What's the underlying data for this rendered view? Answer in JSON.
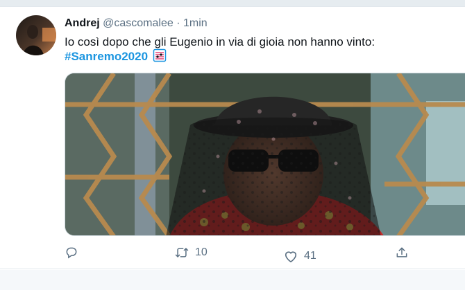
{
  "tweet": {
    "author_name": "Andrej",
    "author_handle": "@cascomalee",
    "separator": "·",
    "time": "1min",
    "text": "Io così dopo che gli Eugenio in via di gioia non hanno vinto:",
    "hashtag": "#Sanremo2020",
    "hashtag_emoji_icon": "musical-score-icon",
    "media_icon": "photo-veiled-figure",
    "actions": {
      "reply": {
        "icon": "reply-icon",
        "count": ""
      },
      "retweet": {
        "icon": "retweet-icon",
        "count": "10"
      },
      "like": {
        "icon": "heart-icon",
        "count": "41"
      },
      "share": {
        "icon": "share-icon",
        "count": ""
      }
    }
  },
  "colors": {
    "accent": "#1b95e0",
    "text_secondary": "#5b7083",
    "divider": "#e6ecf0"
  }
}
